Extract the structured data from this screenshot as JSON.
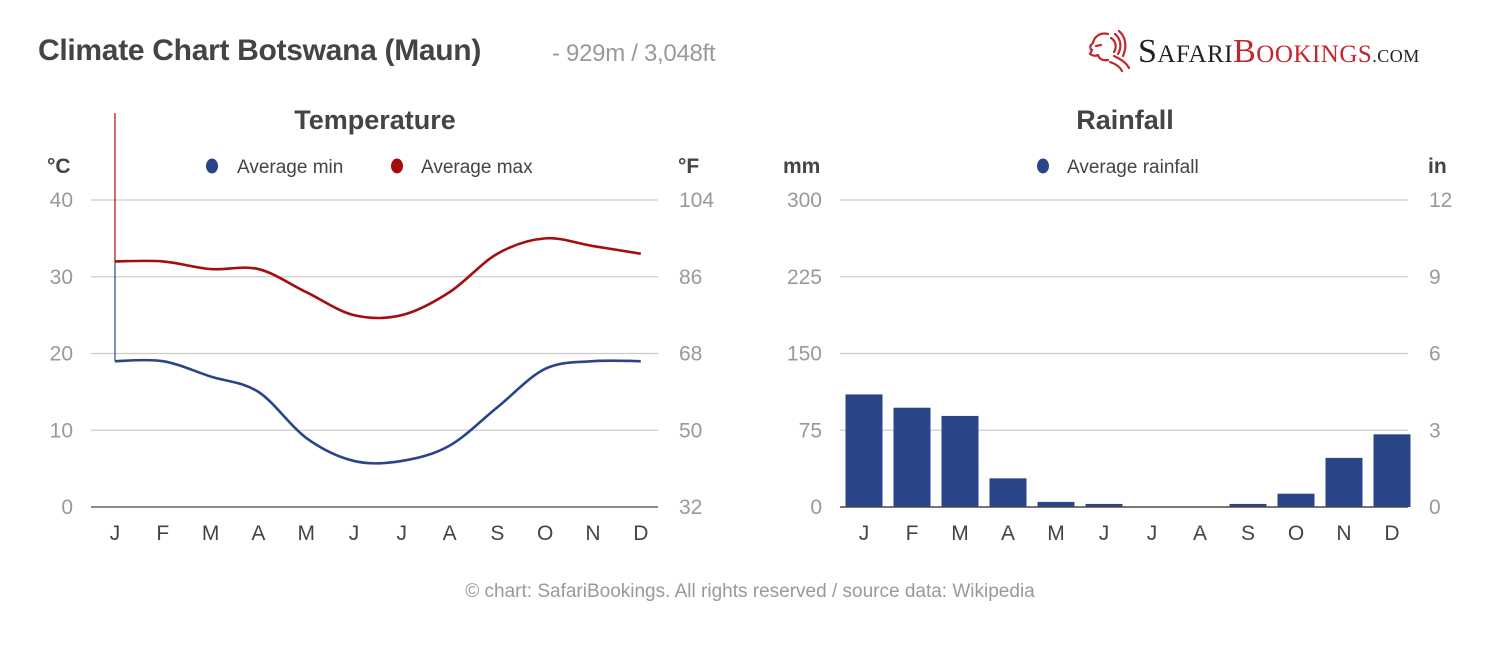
{
  "header": {
    "title": "Climate Chart Botswana (Maun)",
    "subtitle": "- 929m / 3,048ft"
  },
  "logo": {
    "icon": "lion-head-icon",
    "safari_first": "S",
    "safari_rest": "AFARI",
    "bookings_first": "B",
    "bookings_rest": "OOKINGS",
    "domain": ".COM"
  },
  "footer": {
    "text": "© chart: SafariBookings. All rights reserved / source data: Wikipedia"
  },
  "colors": {
    "min": "#2a4488",
    "max": "#a30d0d",
    "bar": "#2a4488",
    "grid": "#cccccc",
    "axis": "#444444",
    "tick": "#999999",
    "text": "#444444"
  },
  "chart_data": [
    {
      "type": "line",
      "title": "Temperature",
      "categories": [
        "J",
        "F",
        "M",
        "A",
        "M",
        "J",
        "J",
        "A",
        "S",
        "O",
        "N",
        "D"
      ],
      "series": [
        {
          "name": "Average min",
          "values": [
            19,
            19,
            17,
            15,
            9,
            6,
            6,
            8,
            13,
            18,
            19,
            19
          ]
        },
        {
          "name": "Average max",
          "values": [
            32,
            32,
            31,
            31,
            28,
            25,
            25,
            28,
            33,
            35,
            34,
            33
          ]
        }
      ],
      "ylabel": "°C",
      "y2label": "°F",
      "ylim": [
        0,
        40
      ],
      "yticks": [
        0,
        10,
        20,
        30,
        40
      ],
      "y2ticks": [
        32,
        50,
        68,
        86,
        104
      ],
      "legend": "top-center",
      "grid": true
    },
    {
      "type": "bar",
      "title": "Rainfall",
      "categories": [
        "J",
        "F",
        "M",
        "A",
        "M",
        "J",
        "J",
        "A",
        "S",
        "O",
        "N",
        "D"
      ],
      "series": [
        {
          "name": "Average rainfall",
          "values": [
            110,
            97,
            89,
            28,
            5,
            3,
            0.5,
            0.5,
            3,
            13,
            48,
            71
          ]
        }
      ],
      "ylabel": "mm",
      "y2label": "in",
      "ylim": [
        0,
        300
      ],
      "yticks": [
        0,
        75,
        150,
        225,
        300
      ],
      "y2ticks": [
        0,
        3,
        6,
        9,
        12
      ],
      "legend": "top-center",
      "grid": true
    }
  ]
}
